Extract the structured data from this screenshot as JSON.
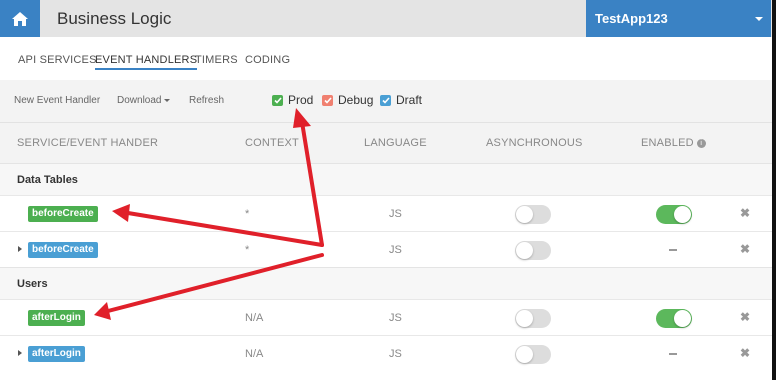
{
  "header": {
    "title": "Business Logic",
    "app_name": "TestApp123"
  },
  "tabs": [
    {
      "label": "API SERVICES"
    },
    {
      "label": "EVENT HANDLERS"
    },
    {
      "label": "TIMERS"
    },
    {
      "label": "CODING"
    }
  ],
  "toolbar": {
    "new_label": "New Event Handler",
    "download_label": "Download",
    "refresh_label": "Refresh",
    "envs": [
      {
        "label": "Prod",
        "color": "#4caf50"
      },
      {
        "label": "Debug",
        "color": "#f08070"
      },
      {
        "label": "Draft",
        "color": "#4a9fd4"
      }
    ]
  },
  "columns": {
    "service": "SERVICE/EVENT HANDER",
    "context": "CONTEXT",
    "language": "LANGUAGE",
    "async": "ASYNCHRONOUS",
    "enabled": "ENABLED"
  },
  "groups": [
    {
      "label": "Data Tables",
      "rows": [
        {
          "name": "beforeCreate",
          "badge_color": "#4caf50",
          "context": "*",
          "language": "JS",
          "async": false,
          "enabled": true
        },
        {
          "name": "beforeCreate",
          "badge_color": "#4a9fd4",
          "context": "*",
          "language": "JS",
          "async": false,
          "enabled": null
        }
      ]
    },
    {
      "label": "Users",
      "rows": [
        {
          "name": "afterLogin",
          "badge_color": "#4caf50",
          "context": "N/A",
          "language": "JS",
          "async": false,
          "enabled": true
        },
        {
          "name": "afterLogin",
          "badge_color": "#4a9fd4",
          "context": "N/A",
          "language": "JS",
          "async": false,
          "enabled": null
        }
      ]
    }
  ],
  "colors": {
    "accent": "#3a82c4",
    "annotation_arrow": "#e0202a"
  }
}
